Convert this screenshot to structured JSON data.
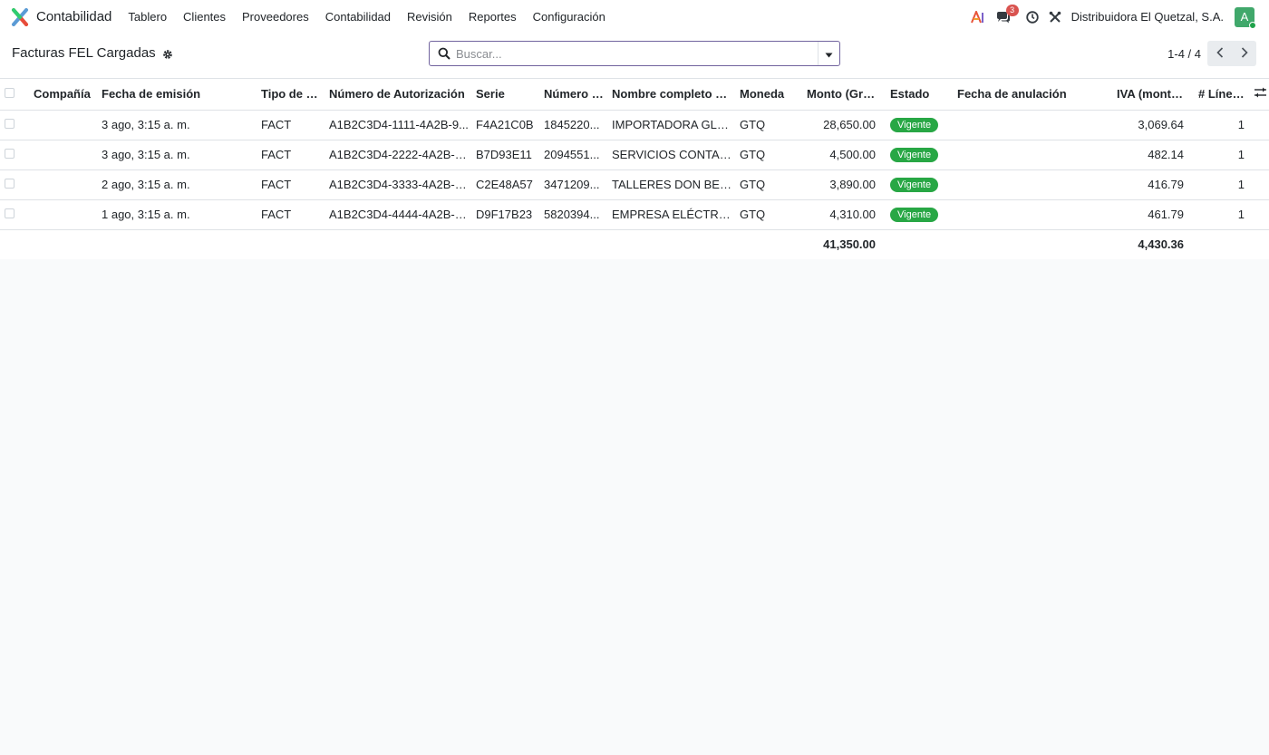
{
  "app": {
    "name": "Contabilidad"
  },
  "menu": [
    "Tablero",
    "Clientes",
    "Proveedores",
    "Contabilidad",
    "Revisión",
    "Reportes",
    "Configuración"
  ],
  "nav_right": {
    "icons": [
      "ai-icon",
      "chat-icon",
      "clock-icon",
      "tools-icon"
    ],
    "message_count": "3",
    "company": "Distribuidora El Quetzal, S.A.",
    "avatar_letter": "A",
    "avatar_color": "#40a86b"
  },
  "view": {
    "title": "Facturas FEL Cargadas"
  },
  "search": {
    "placeholder": "Buscar...",
    "value": ""
  },
  "pager": {
    "value": "1-4 / 4"
  },
  "table": {
    "columns": [
      "Compañía",
      "Fecha de emisión",
      "Tipo de D...",
      "Número de Autorización",
      "Serie",
      "Número d...",
      "Nombre completo del ...",
      "Moneda",
      "Monto (Gra...",
      "Estado",
      "Fecha de anulación",
      "IVA (monto ...",
      "# Líneas"
    ],
    "rows": [
      {
        "compania": "",
        "fecha": "3 ago, 3:15 a. m.",
        "tipo": "FACT",
        "autorizacion": "A1B2C3D4-1111-4A2B-9...",
        "serie": "F4A21C0B",
        "numero": "1845220...",
        "nombre": "IMPORTADORA GLOB...",
        "moneda": "GTQ",
        "monto": "28,650.00",
        "estado": "Vigente",
        "anulacion": "",
        "iva": "3,069.64",
        "lineas": "1"
      },
      {
        "compania": "",
        "fecha": "3 ago, 3:15 a. m.",
        "tipo": "FACT",
        "autorizacion": "A1B2C3D4-2222-4A2B-9...",
        "serie": "B7D93E11",
        "numero": "2094551...",
        "nombre": "SERVICIOS CONTABLE...",
        "moneda": "GTQ",
        "monto": "4,500.00",
        "estado": "Vigente",
        "anulacion": "",
        "iva": "482.14",
        "lineas": "1"
      },
      {
        "compania": "",
        "fecha": "2 ago, 3:15 a. m.",
        "tipo": "FACT",
        "autorizacion": "A1B2C3D4-3333-4A2B-9...",
        "serie": "C2E48A57",
        "numero": "3471209...",
        "nombre": "TALLERES DON BETO",
        "moneda": "GTQ",
        "monto": "3,890.00",
        "estado": "Vigente",
        "anulacion": "",
        "iva": "416.79",
        "lineas": "1"
      },
      {
        "compania": "",
        "fecha": "1 ago, 3:15 a. m.",
        "tipo": "FACT",
        "autorizacion": "A1B2C3D4-4444-4A2B-9...",
        "serie": "D9F17B23",
        "numero": "5820394...",
        "nombre": "EMPRESA ELÉCTRICA ...",
        "moneda": "GTQ",
        "monto": "4,310.00",
        "estado": "Vigente",
        "anulacion": "",
        "iva": "461.79",
        "lineas": "1"
      }
    ],
    "totals": {
      "monto": "41,350.00",
      "iva": "4,430.36"
    }
  },
  "colors": {
    "accent": "#71639e",
    "status_green": "#28a745",
    "badge_red": "#d9534f"
  }
}
